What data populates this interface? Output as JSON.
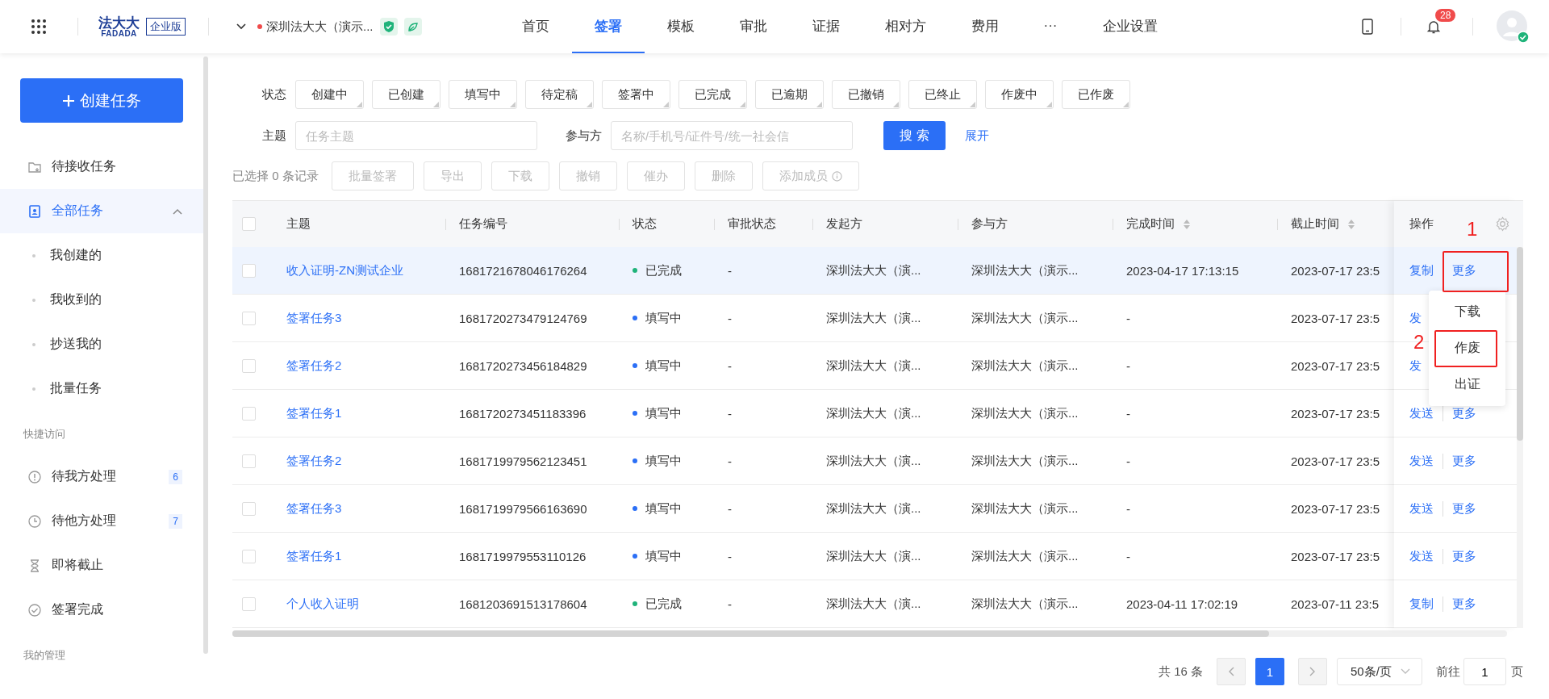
{
  "header": {
    "logo": {
      "mark": "法大大",
      "wordmark": "FADADA",
      "edition": "企业版"
    },
    "company": "深圳法大大（演示...",
    "nav": [
      {
        "label": "首页",
        "selected": false
      },
      {
        "label": "签署",
        "selected": true
      },
      {
        "label": "模板",
        "selected": false
      },
      {
        "label": "审批",
        "selected": false
      },
      {
        "label": "证据",
        "selected": false
      },
      {
        "label": "相对方",
        "selected": false
      },
      {
        "label": "费用",
        "selected": false
      },
      {
        "label": "···",
        "selected": false
      },
      {
        "label": "企业设置",
        "selected": false
      }
    ],
    "notification_count": "28"
  },
  "sidebar": {
    "create_button": "创建任务",
    "items": [
      {
        "label": "待接收任务",
        "selected": false
      },
      {
        "label": "全部任务",
        "selected": true,
        "expanded": true,
        "children": [
          {
            "label": "我创建的"
          },
          {
            "label": "我收到的"
          },
          {
            "label": "抄送我的"
          },
          {
            "label": "批量任务"
          }
        ]
      }
    ],
    "sections": [
      {
        "title": "快捷访问",
        "items": [
          {
            "label": "待我方处理",
            "count": "6"
          },
          {
            "label": "待他方处理",
            "count": "7"
          },
          {
            "label": "即将截止"
          },
          {
            "label": "签署完成"
          }
        ]
      },
      {
        "title": "我的管理"
      }
    ]
  },
  "filters": {
    "status_label": "状态",
    "status_tags": [
      {
        "label": "创建中",
        "selected": false
      },
      {
        "label": "已创建",
        "selected": false
      },
      {
        "label": "填写中",
        "selected": false
      },
      {
        "label": "待定稿",
        "selected": false
      },
      {
        "label": "签署中",
        "selected": false
      },
      {
        "label": "已完成",
        "selected": false
      },
      {
        "label": "已逾期",
        "selected": false
      },
      {
        "label": "已撤销",
        "selected": false
      },
      {
        "label": "已终止",
        "selected": false
      },
      {
        "label": "作废中",
        "selected": false
      },
      {
        "label": "已作废",
        "selected": false
      }
    ],
    "subject": {
      "label": "主题",
      "placeholder": "任务主题"
    },
    "party": {
      "label": "参与方",
      "placeholder": "名称/手机号/证件号/统一社会信"
    },
    "search_button": "搜 索",
    "expand_link": "展开"
  },
  "toolbar": {
    "selection": "已选择 0 条记录",
    "buttons": [
      {
        "label": "批量签署",
        "disabled": true
      },
      {
        "label": "导出",
        "disabled": true
      },
      {
        "label": "下载",
        "disabled": true
      },
      {
        "label": "撤销",
        "disabled": true
      },
      {
        "label": "催办",
        "disabled": true
      },
      {
        "label": "删除",
        "disabled": true
      },
      {
        "label": "添加成员",
        "disabled": true,
        "info": true
      }
    ]
  },
  "table": {
    "select_all_checked": false,
    "columns": [
      {
        "label": "主题",
        "sortable": false
      },
      {
        "label": "任务编号",
        "sortable": false
      },
      {
        "label": "状态",
        "sortable": false
      },
      {
        "label": "审批状态",
        "sortable": false
      },
      {
        "label": "发起方",
        "sortable": false
      },
      {
        "label": "参与方",
        "sortable": false
      },
      {
        "label": "完成时间",
        "sortable": true
      },
      {
        "label": "截止时间",
        "sortable": true
      },
      {
        "label": "操作",
        "sortable": false
      }
    ],
    "rows": [
      {
        "selected": true,
        "checked": false,
        "subject": "收入证明-ZN测试企业",
        "task_no": "1681721678046176264",
        "status": "已完成",
        "color": "#1fb37a",
        "approval": "-",
        "initiator": "深圳法大大（演...",
        "participant": "深圳法大大（演示...",
        "completed": "2023-04-17 17:13:15",
        "deadline": "2023-07-17 23:5",
        "actions": [
          "复制",
          "更多"
        ]
      },
      {
        "selected": false,
        "checked": false,
        "subject": "签署任务3",
        "task_no": "1681720273479124769",
        "status": "填写中",
        "color": "#2b6ff6",
        "approval": "-",
        "initiator": "深圳法大大（演...",
        "participant": "深圳法大大（演示...",
        "completed": "-",
        "deadline": "2023-07-17 23:5",
        "actions": [
          "发"
        ]
      },
      {
        "selected": false,
        "checked": false,
        "subject": "签署任务2",
        "task_no": "1681720273456184829",
        "status": "填写中",
        "color": "#2b6ff6",
        "approval": "-",
        "initiator": "深圳法大大（演...",
        "participant": "深圳法大大（演示...",
        "completed": "-",
        "deadline": "2023-07-17 23:5",
        "actions": [
          "发"
        ]
      },
      {
        "selected": false,
        "checked": false,
        "subject": "签署任务1",
        "task_no": "1681720273451183396",
        "status": "填写中",
        "color": "#2b6ff6",
        "approval": "-",
        "initiator": "深圳法大大（演...",
        "participant": "深圳法大大（演示...",
        "completed": "-",
        "deadline": "2023-07-17 23:5",
        "actions": [
          "发送",
          "更多"
        ]
      },
      {
        "selected": false,
        "checked": false,
        "subject": "签署任务2",
        "task_no": "1681719979562123451",
        "status": "填写中",
        "color": "#2b6ff6",
        "approval": "-",
        "initiator": "深圳法大大（演...",
        "participant": "深圳法大大（演示...",
        "completed": "-",
        "deadline": "2023-07-17 23:5",
        "actions": [
          "发送",
          "更多"
        ]
      },
      {
        "selected": false,
        "checked": false,
        "subject": "签署任务3",
        "task_no": "1681719979566163690",
        "status": "填写中",
        "color": "#2b6ff6",
        "approval": "-",
        "initiator": "深圳法大大（演...",
        "participant": "深圳法大大（演示...",
        "completed": "-",
        "deadline": "2023-07-17 23:5",
        "actions": [
          "发送",
          "更多"
        ]
      },
      {
        "selected": false,
        "checked": false,
        "subject": "签署任务1",
        "task_no": "1681719979553110126",
        "status": "填写中",
        "color": "#2b6ff6",
        "approval": "-",
        "initiator": "深圳法大大（演...",
        "participant": "深圳法大大（演示...",
        "completed": "-",
        "deadline": "2023-07-17 23:5",
        "actions": [
          "发送",
          "更多"
        ]
      },
      {
        "selected": false,
        "checked": false,
        "subject": "个人收入证明",
        "task_no": "1681203691513178604",
        "status": "已完成",
        "color": "#1fb37a",
        "approval": "-",
        "initiator": "深圳法大大（演...",
        "participant": "深圳法大大（演示...",
        "completed": "2023-04-11 17:02:19",
        "deadline": "2023-07-11 23:5",
        "actions": [
          "复制",
          "更多"
        ]
      }
    ]
  },
  "dropdown": {
    "items": [
      "下载",
      "作废",
      "出证"
    ]
  },
  "annotations": [
    {
      "number": "1"
    },
    {
      "number": "2"
    }
  ],
  "pagination": {
    "total": "共 16 条",
    "pages": [
      {
        "label": "1",
        "selected": true
      }
    ],
    "page_size": "50条/页",
    "goto_label": "前往",
    "goto_value": "1",
    "page_suffix": "页"
  }
}
